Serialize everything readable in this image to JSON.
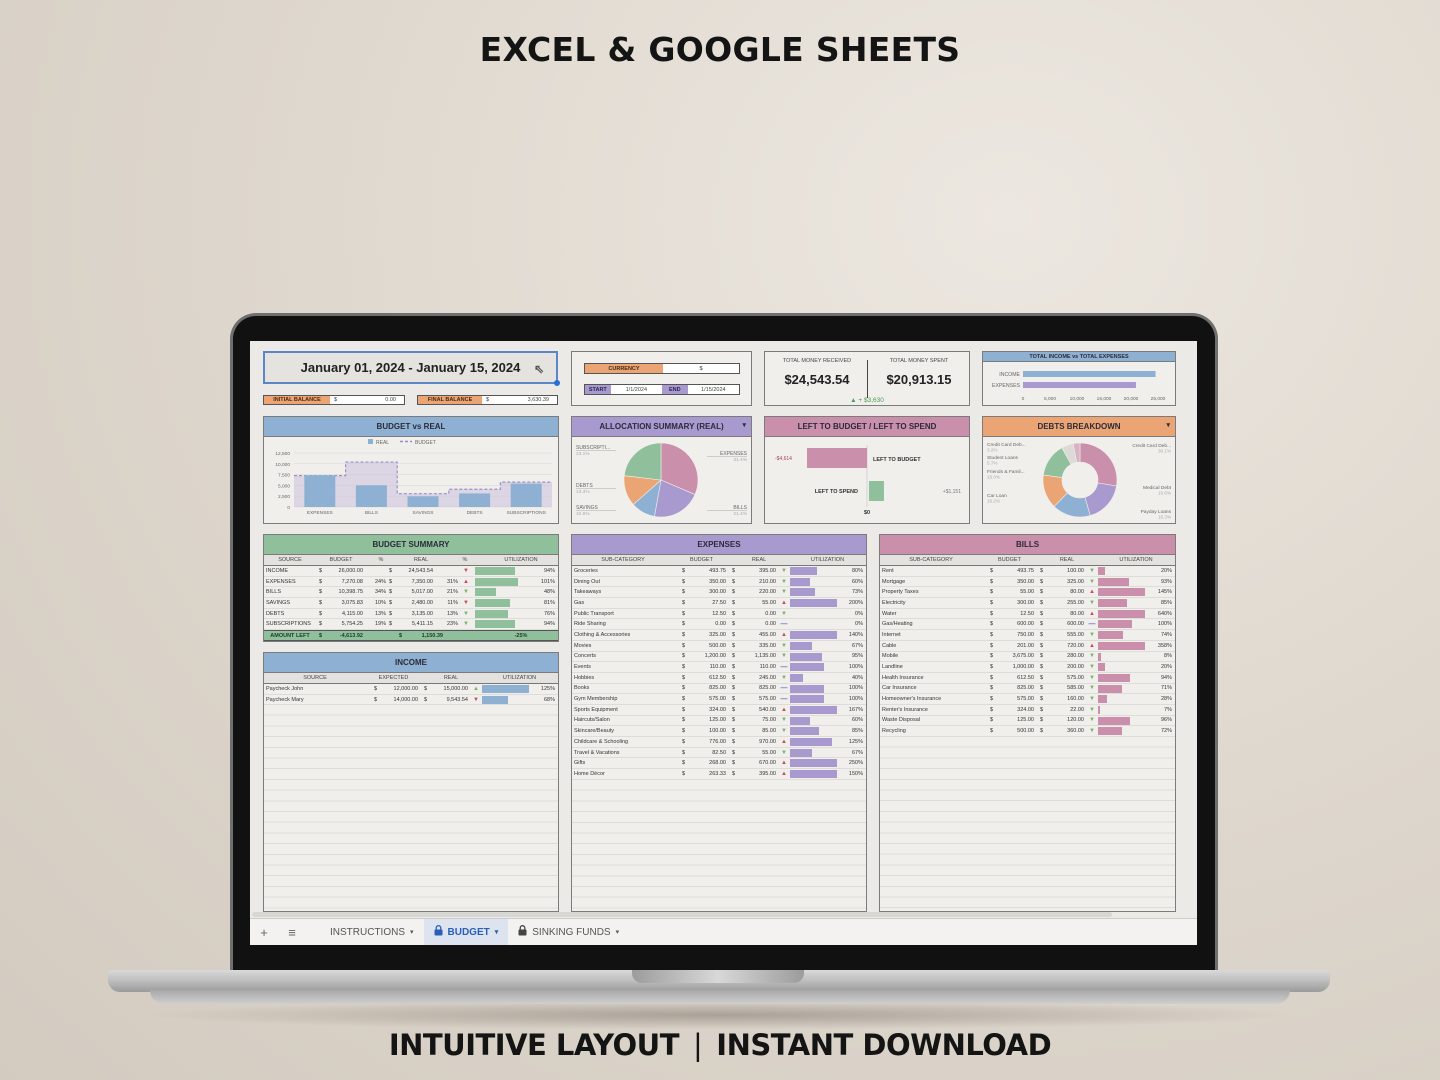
{
  "promo": {
    "headline": "EXCEL & GOOGLE SHEETS",
    "footer_left": "INTUITIVE LAYOUT",
    "footer_sep": "|",
    "footer_right": "INSTANT DOWNLOAD"
  },
  "header": {
    "date_range": "January 01, 2024 - January 15, 2024",
    "initial_balance_label": "INITIAL BALANCE",
    "initial_balance_currency": "$",
    "initial_balance_value": "0.00",
    "final_balance_label": "FINAL BALANCE",
    "final_balance_currency": "$",
    "final_balance_value": "3,630.39"
  },
  "settings": {
    "currency_label": "CURRENCY",
    "currency_value": "$",
    "start_label": "START",
    "start_value": "1/1/2024",
    "end_label": "END",
    "end_value": "1/15/2024"
  },
  "totals": {
    "received_label": "TOTAL MONEY RECEIVED",
    "received_value": "$24,543.54",
    "spent_label": "TOTAL MONEY SPENT",
    "spent_value": "$20,913.15",
    "difference": "▲ + $3,630"
  },
  "colors": {
    "blue": "#8eb0d3",
    "purple": "#a899cf",
    "pink": "#c98fab",
    "orange": "#eba574",
    "green": "#8fc09b",
    "up_red": "#c94a5c",
    "down_green": "#7bb06b"
  },
  "chart_data": [
    {
      "id": "income_vs_expenses",
      "type": "bar",
      "orientation": "horizontal",
      "title": "TOTAL INCOME vs TOTAL EXPENSES",
      "categories": [
        "INCOME",
        "EXPENSES"
      ],
      "values": [
        24543.54,
        20913.15
      ],
      "colors": [
        "#8eb0d3",
        "#a899cf"
      ],
      "xlim": [
        0,
        25000
      ],
      "xticks": [
        "0",
        "5,000",
        "10,000",
        "15,000",
        "20,000",
        "25,000"
      ]
    },
    {
      "id": "budget_vs_real",
      "type": "bar",
      "title": "BUDGET vs REAL",
      "categories": [
        "EXPENSES",
        "BILLS",
        "SAVINGS",
        "DEBTS",
        "SUBSCRIPTIONS"
      ],
      "series": [
        {
          "name": "REAL",
          "values": [
            7350,
            5017,
            2480,
            3135,
            5411.15
          ],
          "style": "bar"
        },
        {
          "name": "BUDGET",
          "values": [
            7270.08,
            10398.75,
            3075.83,
            4115,
            5754.25
          ],
          "style": "dashed-step-area"
        }
      ],
      "ylim": [
        0,
        12500
      ],
      "yticks": [
        "0",
        "2,500",
        "5,000",
        "7,500",
        "10,000",
        "12,500"
      ],
      "legend": "top"
    },
    {
      "id": "allocation_summary",
      "type": "pie",
      "title": "ALLOCATION SUMMARY (REAL)",
      "slices": [
        {
          "label": "EXPENSES",
          "value": 31.4,
          "pct": "31.4%",
          "color": "#c98fab"
        },
        {
          "label": "BILLS",
          "value": 21.4,
          "pct": "21.4%",
          "color": "#a899cf"
        },
        {
          "label": "SAVINGS",
          "value": 10.6,
          "pct": "10.6%",
          "color": "#8eb0d3"
        },
        {
          "label": "DEBTS",
          "value": 13.4,
          "pct": "13.4%",
          "color": "#eba574"
        },
        {
          "label": "SUBSCRIPTI...",
          "value": 23.1,
          "pct": "23.1%",
          "color": "#8fc09b"
        }
      ]
    },
    {
      "id": "left_to_budget_spend",
      "type": "bar",
      "title": "LEFT TO BUDGET / LEFT TO SPEND",
      "categories": [
        "LEFT TO BUDGET",
        "LEFT TO SPEND"
      ],
      "values": [
        -4614,
        1151
      ],
      "value_labels": [
        "-$4,614",
        "+$1,151"
      ],
      "colors": [
        "#c98fab",
        "#8fc09b"
      ],
      "zero_label": "$0"
    },
    {
      "id": "debts_breakdown",
      "type": "pie",
      "donut": true,
      "title": "DEBTS BREAKDOWN",
      "slices": [
        {
          "label": "Credit Card Deb...",
          "value": 30.1,
          "pct": "30.1%",
          "color": "#c98fab"
        },
        {
          "label": "Medical Debt",
          "value": 19.6,
          "pct": "19.6%",
          "color": "#a899cf"
        },
        {
          "label": "Payday Loans",
          "value": 18.3,
          "pct": "18.3%",
          "color": "#8eb0d3"
        },
        {
          "label": "Car Loan",
          "value": 16.2,
          "pct": "16.2%",
          "color": "#eba574"
        },
        {
          "label": "Friends & Famil...",
          "value": 16.0,
          "pct": "16.0%",
          "color": "#8fc09b"
        },
        {
          "label": "Student Loans",
          "value": 5.7,
          "pct": "5.7%",
          "color": "#dcdad6"
        },
        {
          "label": "Credit Card Deb...",
          "value": 3.2,
          "pct": "3.2%",
          "color": "#d8b3c4"
        }
      ]
    }
  ],
  "budget_summary": {
    "title": "BUDGET SUMMARY",
    "columns": [
      "SOURCE",
      "BUDGET",
      "%",
      "REAL",
      "%",
      "UTILIZATION"
    ],
    "rows": [
      {
        "source": "INCOME",
        "budget": "26,000.00",
        "bpct": "",
        "real": "24,543.54",
        "rpct": "",
        "trend": "down-red",
        "util": 94,
        "util_label": "94%"
      },
      {
        "source": "EXPENSES",
        "budget": "7,270.08",
        "bpct": "24%",
        "real": "7,350.00",
        "rpct": "31%",
        "trend": "up",
        "util": 101,
        "util_label": "101%"
      },
      {
        "source": "BILLS",
        "budget": "10,398.75",
        "bpct": "34%",
        "real": "5,017.00",
        "rpct": "21%",
        "trend": "down",
        "util": 48,
        "util_label": "48%"
      },
      {
        "source": "SAVINGS",
        "budget": "3,075.83",
        "bpct": "10%",
        "real": "2,480.00",
        "rpct": "11%",
        "trend": "down-red",
        "util": 81,
        "util_label": "81%"
      },
      {
        "source": "DEBTS",
        "budget": "4,115.00",
        "bpct": "13%",
        "real": "3,135.00",
        "rpct": "13%",
        "trend": "down",
        "util": 76,
        "util_label": "76%"
      },
      {
        "source": "SUBSCRIPTIONS",
        "budget": "5,754.25",
        "bpct": "19%",
        "real": "5,411.15",
        "rpct": "23%",
        "trend": "down",
        "util": 94,
        "util_label": "94%"
      }
    ],
    "total": {
      "label": "AMOUNT LEFT",
      "budget": "-4,613.92",
      "real": "1,150.39",
      "util": "-25%"
    }
  },
  "income": {
    "title": "INCOME",
    "columns": [
      "SOURCE",
      "EXPECTED",
      "REAL",
      "UTILIZATION"
    ],
    "rows": [
      {
        "source": "Paycheck John",
        "expected": "12,000.00",
        "real": "15,000.00",
        "trend": "up-green",
        "util": 125,
        "util_label": "125%"
      },
      {
        "source": "Paycheck Mary",
        "expected": "14,000.00",
        "real": "9,543.54",
        "trend": "down-red",
        "util": 68,
        "util_label": "68%"
      }
    ]
  },
  "expenses": {
    "title": "EXPENSES",
    "columns": [
      "SUB-CATEGORY",
      "BUDGET",
      "REAL",
      "UTILIZATION"
    ],
    "rows": [
      {
        "name": "Groceries",
        "budget": "493.75",
        "real": "395.00",
        "trend": "down",
        "util": 80,
        "util_label": "80%"
      },
      {
        "name": "Dining Out",
        "budget": "350.00",
        "real": "210.00",
        "trend": "down",
        "util": 60,
        "util_label": "60%"
      },
      {
        "name": "Takeaways",
        "budget": "300.00",
        "real": "220.00",
        "trend": "down",
        "util": 73,
        "util_label": "73%"
      },
      {
        "name": "Gas",
        "budget": "27.50",
        "real": "55.00",
        "trend": "up",
        "util": 200,
        "util_label": "200%"
      },
      {
        "name": "Public Transport",
        "budget": "12.50",
        "real": "0.00",
        "trend": "down",
        "util": 0,
        "util_label": "0%"
      },
      {
        "name": "Ride Sharing",
        "budget": "0.00",
        "real": "0.00",
        "trend": "eq",
        "util": 0,
        "util_label": "0%"
      },
      {
        "name": "Clothing & Accessories",
        "budget": "325.00",
        "real": "455.00",
        "trend": "up",
        "util": 140,
        "util_label": "140%"
      },
      {
        "name": "Movies",
        "budget": "500.00",
        "real": "335.00",
        "trend": "down",
        "util": 67,
        "util_label": "67%"
      },
      {
        "name": "Concerts",
        "budget": "1,200.00",
        "real": "1,135.00",
        "trend": "down",
        "util": 95,
        "util_label": "95%"
      },
      {
        "name": "Events",
        "budget": "110.00",
        "real": "110.00",
        "trend": "eq",
        "util": 100,
        "util_label": "100%"
      },
      {
        "name": "Hobbies",
        "budget": "612.50",
        "real": "245.00",
        "trend": "down",
        "util": 40,
        "util_label": "40%"
      },
      {
        "name": "Books",
        "budget": "825.00",
        "real": "825.00",
        "trend": "eq",
        "util": 100,
        "util_label": "100%"
      },
      {
        "name": "Gym Membership",
        "budget": "575.00",
        "real": "575.00",
        "trend": "eq",
        "util": 100,
        "util_label": "100%"
      },
      {
        "name": "Sports Equipment",
        "budget": "324.00",
        "real": "540.00",
        "trend": "up",
        "util": 167,
        "util_label": "167%"
      },
      {
        "name": "Haircuts/Salon",
        "budget": "125.00",
        "real": "75.00",
        "trend": "down",
        "util": 60,
        "util_label": "60%"
      },
      {
        "name": "Skincare/Beauty",
        "budget": "100.00",
        "real": "85.00",
        "trend": "down",
        "util": 85,
        "util_label": "85%"
      },
      {
        "name": "Childcare & Schooling",
        "budget": "776.00",
        "real": "970.00",
        "trend": "up",
        "util": 125,
        "util_label": "125%"
      },
      {
        "name": "Travel & Vacations",
        "budget": "82.50",
        "real": "55.00",
        "trend": "down",
        "util": 67,
        "util_label": "67%"
      },
      {
        "name": "Gifts",
        "budget": "268.00",
        "real": "670.00",
        "trend": "up",
        "util": 250,
        "util_label": "250%"
      },
      {
        "name": "Home Décor",
        "budget": "263.33",
        "real": "395.00",
        "trend": "up",
        "util": 150,
        "util_label": "150%"
      }
    ]
  },
  "bills": {
    "title": "BILLS",
    "columns": [
      "SUB-CATEGORY",
      "BUDGET",
      "REAL",
      "UTILIZATION"
    ],
    "rows": [
      {
        "name": "Rent",
        "budget": "493.75",
        "real": "100.00",
        "trend": "down",
        "util": 20,
        "util_label": "20%"
      },
      {
        "name": "Mortgage",
        "budget": "350.00",
        "real": "325.00",
        "trend": "down",
        "util": 93,
        "util_label": "93%"
      },
      {
        "name": "Property Taxes",
        "budget": "55.00",
        "real": "80.00",
        "trend": "up",
        "util": 145,
        "util_label": "145%"
      },
      {
        "name": "Electricity",
        "budget": "300.00",
        "real": "255.00",
        "trend": "down",
        "util": 85,
        "util_label": "85%"
      },
      {
        "name": "Water",
        "budget": "12.50",
        "real": "80.00",
        "trend": "up",
        "util": 640,
        "util_label": "640%"
      },
      {
        "name": "Gas/Heating",
        "budget": "600.00",
        "real": "600.00",
        "trend": "eq",
        "util": 100,
        "util_label": "100%"
      },
      {
        "name": "Internet",
        "budget": "750.00",
        "real": "555.00",
        "trend": "down",
        "util": 74,
        "util_label": "74%"
      },
      {
        "name": "Cable",
        "budget": "201.00",
        "real": "720.00",
        "trend": "up",
        "util": 358,
        "util_label": "358%"
      },
      {
        "name": "Mobile",
        "budget": "3,675.00",
        "real": "280.00",
        "trend": "down",
        "util": 8,
        "util_label": "8%"
      },
      {
        "name": "Landline",
        "budget": "1,000.00",
        "real": "200.00",
        "trend": "down",
        "util": 20,
        "util_label": "20%"
      },
      {
        "name": "Health Insurance",
        "budget": "612.50",
        "real": "575.00",
        "trend": "down",
        "util": 94,
        "util_label": "94%"
      },
      {
        "name": "Car Insurance",
        "budget": "825.00",
        "real": "585.00",
        "trend": "down",
        "util": 71,
        "util_label": "71%"
      },
      {
        "name": "Homeowner's Insurance",
        "budget": "575.00",
        "real": "160.00",
        "trend": "down",
        "util": 28,
        "util_label": "28%"
      },
      {
        "name": "Renter's Insurance",
        "budget": "324.00",
        "real": "22.00",
        "trend": "down",
        "util": 7,
        "util_label": "7%"
      },
      {
        "name": "Waste Disposal",
        "budget": "125.00",
        "real": "120.00",
        "trend": "down",
        "util": 96,
        "util_label": "96%"
      },
      {
        "name": "Recycling",
        "budget": "500.00",
        "real": "360.00",
        "trend": "down",
        "util": 72,
        "util_label": "72%"
      }
    ]
  },
  "tabs": {
    "add_icon": "+",
    "menu_icon": "≡",
    "items": [
      {
        "label": "INSTRUCTIONS",
        "locked": false,
        "active": false
      },
      {
        "label": "BUDGET",
        "locked": true,
        "active": true
      },
      {
        "label": "SINKING FUNDS",
        "locked": true,
        "active": false
      }
    ],
    "caret": "▾",
    "lock_icon": "🔒"
  }
}
